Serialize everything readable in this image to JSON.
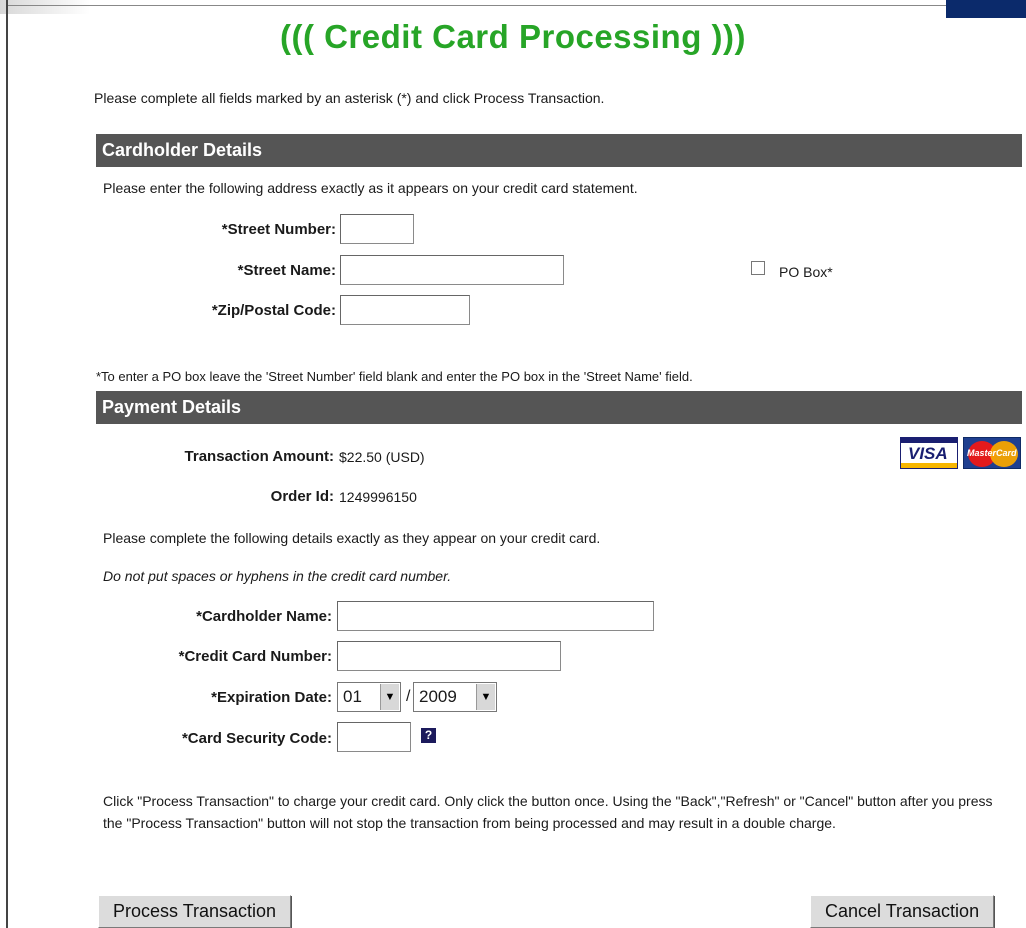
{
  "header": {
    "title": "((( Credit Card Processing )))",
    "instructions": "Please complete all fields marked by an asterisk (*) and click Process Transaction."
  },
  "cardholder": {
    "section_title": "Cardholder Details",
    "note": "Please enter the following address exactly as it appears on your credit card statement.",
    "street_number_label": "*Street Number:",
    "street_number_value": "",
    "street_name_label": "*Street Name:",
    "street_name_value": "",
    "zip_label": "*Zip/Postal Code:",
    "zip_value": "",
    "po_box_label": "PO Box*",
    "po_box_checked": false,
    "po_note": "*To enter a PO box leave the 'Street Number' field blank and enter the PO box in the 'Street Name' field."
  },
  "payment": {
    "section_title": "Payment Details",
    "amount_label": "Transaction Amount:",
    "amount_value": "$22.50 (USD)",
    "order_label": "Order Id:",
    "order_value": "1249996150",
    "card_note": "Please complete the following details exactly as they appear on your credit card.",
    "spacing_note": "Do not put spaces or hyphens in the credit card number.",
    "cardholder_name_label": "*Cardholder Name:",
    "cardholder_name_value": "",
    "card_number_label": "*Credit Card Number:",
    "card_number_value": "",
    "expiration_label": "*Expiration Date:",
    "exp_month": "01",
    "exp_separator": "/",
    "exp_year": "2009",
    "security_code_label": "*Card Security Code:",
    "security_code_value": "",
    "help_icon_glyph": "?",
    "card_logos": {
      "visa_text": "VISA",
      "mastercard_text": "MasterCard"
    }
  },
  "footer": {
    "disclaimer": "Click \"Process Transaction\" to charge your credit card. Only click the button once. Using the \"Back\",\"Refresh\" or \"Cancel\" button after you press the \"Process Transaction\" button will not stop the transaction from being processed and may result in a double charge.",
    "process_button": "Process Transaction",
    "cancel_button": "Cancel Transaction"
  },
  "colors": {
    "title_green": "#27a527",
    "section_bar": "#555555"
  }
}
